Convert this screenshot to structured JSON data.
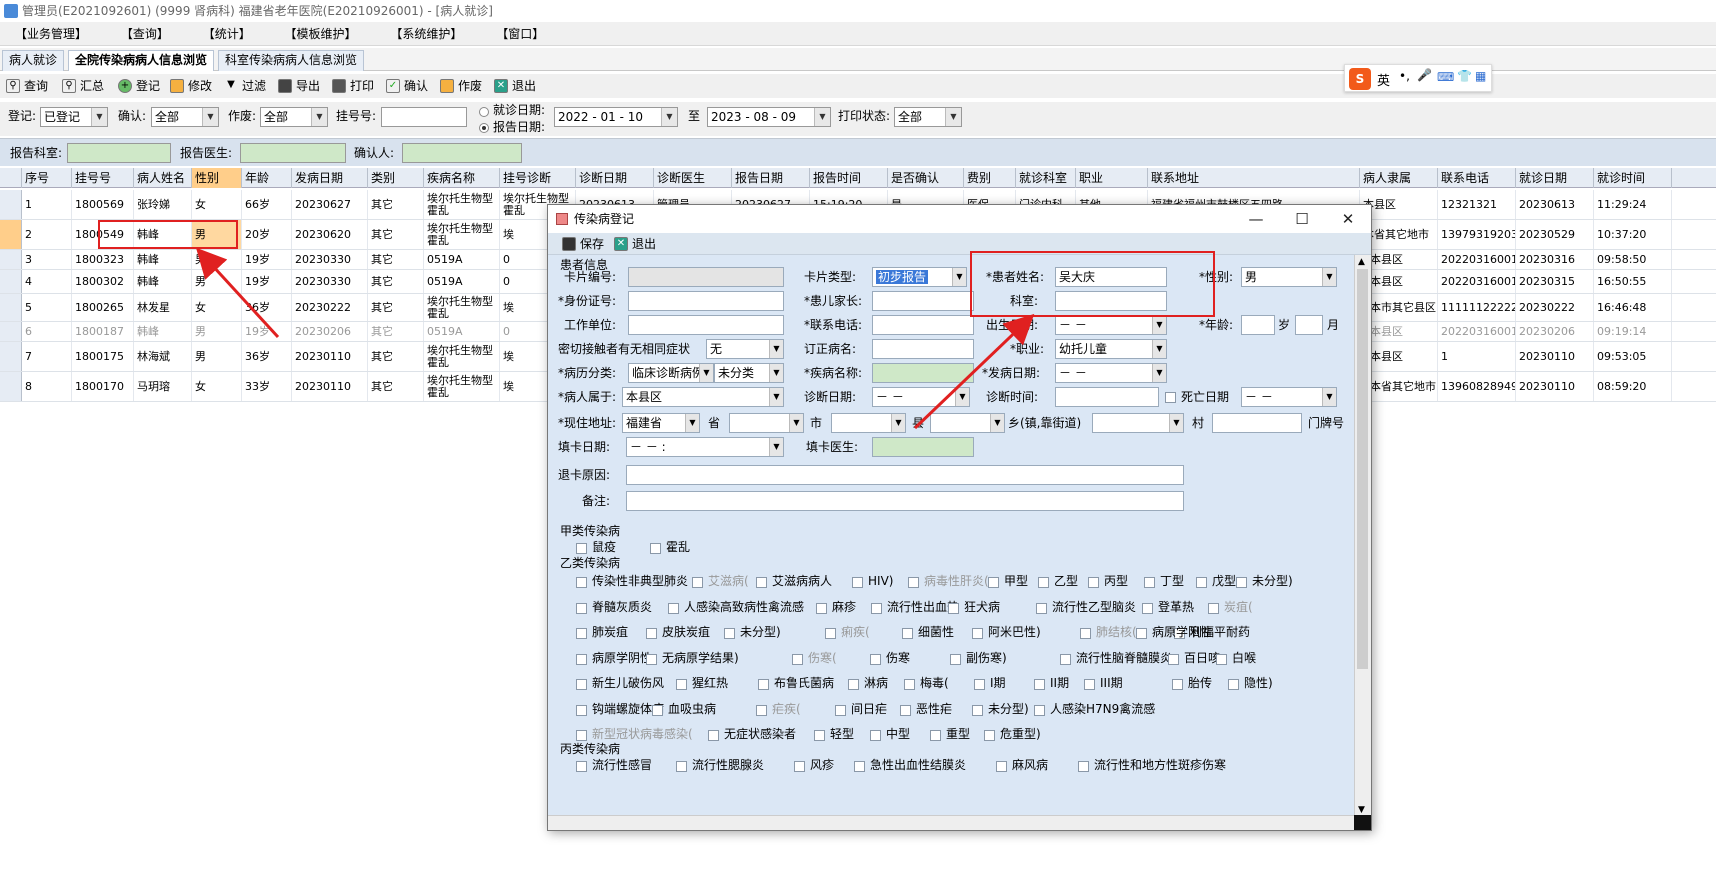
{
  "window_title": "管理员(E2021092601) (9999 肾病科) 福建省老年医院(E20210926001) - [病人就诊]",
  "menu": [
    "【业务管理】",
    "【查询】",
    "【统计】",
    "【模板维护】",
    "【系统维护】",
    "【窗口】"
  ],
  "tabs": [
    "病人就诊",
    "全院传染病病人信息浏览",
    "科室传染病病人信息浏览"
  ],
  "toolbar": [
    "查询",
    "汇总",
    "登记",
    "修改",
    "过滤",
    "导出",
    "打印",
    "确认",
    "作废",
    "退出"
  ],
  "filters": {
    "reg_label": "登记:",
    "reg_value": "已登记",
    "confirm_label": "确认:",
    "confirm_value": "全部",
    "void_label": "作废:",
    "void_value": "全部",
    "regno_label": "挂号号:",
    "visit_date_label": "就诊日期:",
    "report_date_label": "报告日期:",
    "date_from": "2022 - 01 - 10",
    "to_label": "至",
    "date_to": "2023 - 08 - 09",
    "print_label": "打印状态:",
    "print_value": "全部"
  },
  "report_bar": {
    "dept_label": "报告科室:",
    "doctor_label": "报告医生:",
    "confirmer_label": "确认人:"
  },
  "table": {
    "headers": [
      "序号",
      "挂号号",
      "病人姓名",
      "性别",
      "年龄",
      "发病日期",
      "类别",
      "疾病名称",
      "挂号诊断",
      "诊断日期",
      "诊断医生",
      "报告日期",
      "报告时间",
      "是否确认",
      "费别",
      "就诊科室",
      "职业",
      "联系地址",
      "病人隶属",
      "联系电话",
      "就诊日期",
      "就诊时间"
    ],
    "rows": [
      [
        "1",
        "1800569",
        "张玲娣",
        "女",
        "66岁",
        "20230627",
        "其它",
        "埃尔托生物型霍乱",
        "埃尔托生物型霍乱",
        "20230613",
        "管理员",
        "20230627",
        "15:19:20",
        "是",
        "医保",
        "门诊内科",
        "其他",
        "福建省福州市鼓楼区五四路",
        "本县区",
        "12321321",
        "20230613",
        "11:29:24"
      ],
      [
        "2",
        "1800549",
        "韩峰",
        "男",
        "20岁",
        "20230620",
        "其它",
        "埃尔托生物型霍乱",
        "埃",
        "",
        "",
        "",
        "",
        "",
        "",
        "",
        "",
        "",
        "本省其它地市",
        "13979319203",
        "20230529",
        "10:37:20"
      ],
      [
        "3",
        "1800323",
        "韩峰",
        "男",
        "19岁",
        "20230330",
        "其它",
        "0519A",
        "0",
        "",
        "",
        "",
        "",
        "",
        "",
        "",
        "",
        "",
        "1本县区",
        "20220316001",
        "20230316",
        "09:58:50"
      ],
      [
        "4",
        "1800302",
        "韩峰",
        "男",
        "19岁",
        "20230330",
        "其它",
        "0519A",
        "0",
        "",
        "",
        "",
        "",
        "",
        "",
        "",
        "",
        "",
        "1本县区",
        "20220316001",
        "20230315",
        "16:50:55"
      ],
      [
        "5",
        "1800265",
        "林发星",
        "女",
        "36岁",
        "20230222",
        "其它",
        "埃尔托生物型霍乱",
        "埃",
        "",
        "",
        "",
        "",
        "",
        "",
        "",
        "",
        "",
        "2本市其它县区",
        "11111122222",
        "20230222",
        "16:46:48"
      ],
      [
        "6",
        "1800187",
        "韩峰",
        "男",
        "19岁",
        "20230206",
        "其它",
        "0519A",
        "0",
        "",
        "",
        "",
        "",
        "",
        "",
        "",
        "",
        "",
        "1本县区",
        "20220316001",
        "20230206",
        "09:19:14"
      ],
      [
        "7",
        "1800175",
        "林海斌",
        "男",
        "36岁",
        "20230110",
        "其它",
        "埃尔托生物型霍乱",
        "埃",
        "",
        "",
        "",
        "",
        "",
        "",
        "",
        "",
        "",
        "1本县区",
        "1",
        "20230110",
        "09:53:05"
      ],
      [
        "8",
        "1800170",
        "马玥瑢",
        "女",
        "33岁",
        "20230110",
        "其它",
        "埃尔托生物型霍乱",
        "埃",
        "",
        "",
        "",
        "",
        "",
        "",
        "",
        "",
        "",
        "3本省其它地市",
        "13960828949",
        "20230110",
        "08:59:20"
      ]
    ]
  },
  "dialog": {
    "title": "传染病登记",
    "save": "保存",
    "exit": "退出",
    "section_patient": "患者信息",
    "card_no": "卡片编号:",
    "card_type": "卡片类型:",
    "card_type_value": "初步报告",
    "patient_name": "*患者姓名:",
    "patient_name_value": "吴大庆",
    "gender": "*性别:",
    "gender_value": "男",
    "id_no": "*身份证号:",
    "parent": "*患儿家长:",
    "dept": "科室:",
    "work_unit": "工作单位:",
    "phone": "*联系电话:",
    "birth": "出生日期:",
    "birth_value": "－   －",
    "age": "*年龄:",
    "age_unit_year": "岁",
    "age_unit_month": "月",
    "close_contact": "密切接触者有无相同症状",
    "close_contact_value": "无",
    "revised_disease": "订正病名:",
    "occupation": "*职业:",
    "occupation_value": "幼托儿童",
    "case_class": "*病历分类:",
    "case_class_value": "临床诊断病例",
    "case_class_value2": "未分类",
    "disease": "*疾病名称:",
    "onset": "*发病日期:",
    "onset_value": "－   －",
    "belongs": "*病人属于:",
    "belongs_value": "本县区",
    "diag_date": "诊断日期:",
    "diag_date_value": "－   －",
    "diag_time": "诊断时间:",
    "death_date": "死亡日期",
    "death_date_value": "－   －",
    "address": "*现住地址:",
    "province_value": "福建省",
    "province": "省",
    "city": "市",
    "county": "县",
    "town": "乡(镇,靠街道)",
    "village": "村",
    "house_no": "门牌号",
    "fill_date": "填卡日期:",
    "fill_date_value": "－   －        :",
    "fill_doctor": "填卡医生:",
    "return_reason": "退卡原因:",
    "remark": "备注:",
    "class_a": "甲类传染病",
    "class_a_items": [
      "鼠疫",
      "霍乱"
    ],
    "class_b": "乙类传染病",
    "class_b_rows": [
      [
        "传染性非典型肺炎",
        "艾滋病(",
        "艾滋病病人",
        "HIV)",
        "病毒性肝炎(",
        "甲型",
        "乙型",
        "丙型",
        "丁型",
        "戊型",
        "未分型)"
      ],
      [
        "脊髓灰质炎",
        "人感染高致病性禽流感",
        "麻疹",
        "流行性出血热",
        "狂犬病",
        "流行性乙型脑炎",
        "登革热",
        "炭疽("
      ],
      [
        "肺炭疽",
        "皮肤炭疽",
        "未分型)",
        "痢疾(",
        "细菌性",
        "阿米巴性)",
        "肺结核(",
        "利福平耐药",
        "病原学阳性"
      ],
      [
        "病原学阴性",
        "无病原学结果)",
        "伤寒(",
        "伤寒",
        "副伤寒)",
        "流行性脑脊髓膜炎",
        "百日咳",
        "白喉"
      ],
      [
        "新生儿破伤风",
        "猩红热",
        "布鲁氏菌病",
        "淋病",
        "梅毒(",
        "I期",
        "II期",
        "III期",
        "胎传",
        "隐性)"
      ],
      [
        "钩端螺旋体病",
        "血吸虫病",
        "疟疾(",
        "间日疟",
        "恶性疟",
        "未分型)",
        "人感染H7N9禽流感"
      ],
      [
        "新型冠状病毒感染(",
        "无症状感染者",
        "轻型",
        "中型",
        "重型",
        "危重型)"
      ]
    ],
    "class_c": "丙类传染病",
    "class_c_items": [
      "流行性感冒",
      "流行性腮腺炎",
      "风疹",
      "急性出血性结膜炎",
      "麻风病",
      "流行性和地方性斑疹伤寒"
    ]
  },
  "ime": {
    "logo": "S",
    "lang": "英"
  }
}
